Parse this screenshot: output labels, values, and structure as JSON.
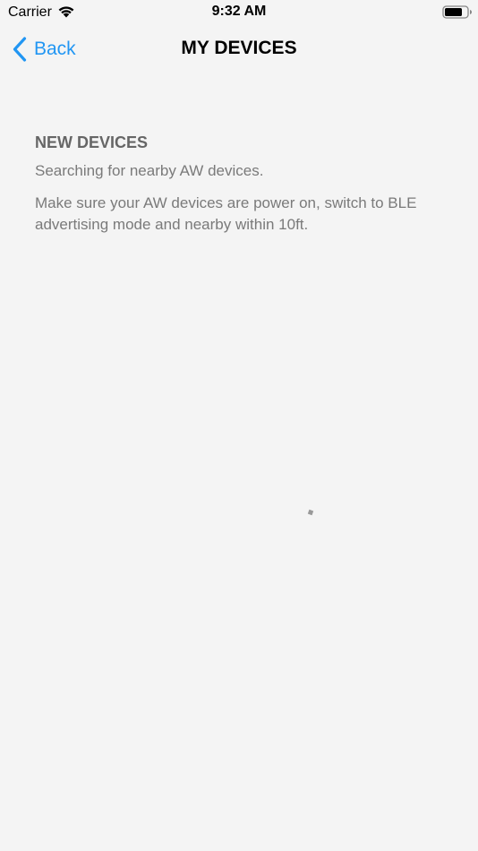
{
  "status_bar": {
    "carrier": "Carrier",
    "time": "9:32 AM",
    "wifi_icon": "wifi-icon",
    "battery_icon": "battery-icon"
  },
  "nav": {
    "back_label": "Back",
    "title": "MY DEVICES",
    "accent_color": "#2196f3"
  },
  "content": {
    "section_title": "NEW DEVICES",
    "searching_text": "Searching for nearby AW devices.",
    "instructions_text": "Make sure your AW devices are power on, switch to BLE advertising mode and nearby within 10ft."
  },
  "loading_indicator": "activity-spinner-icon"
}
